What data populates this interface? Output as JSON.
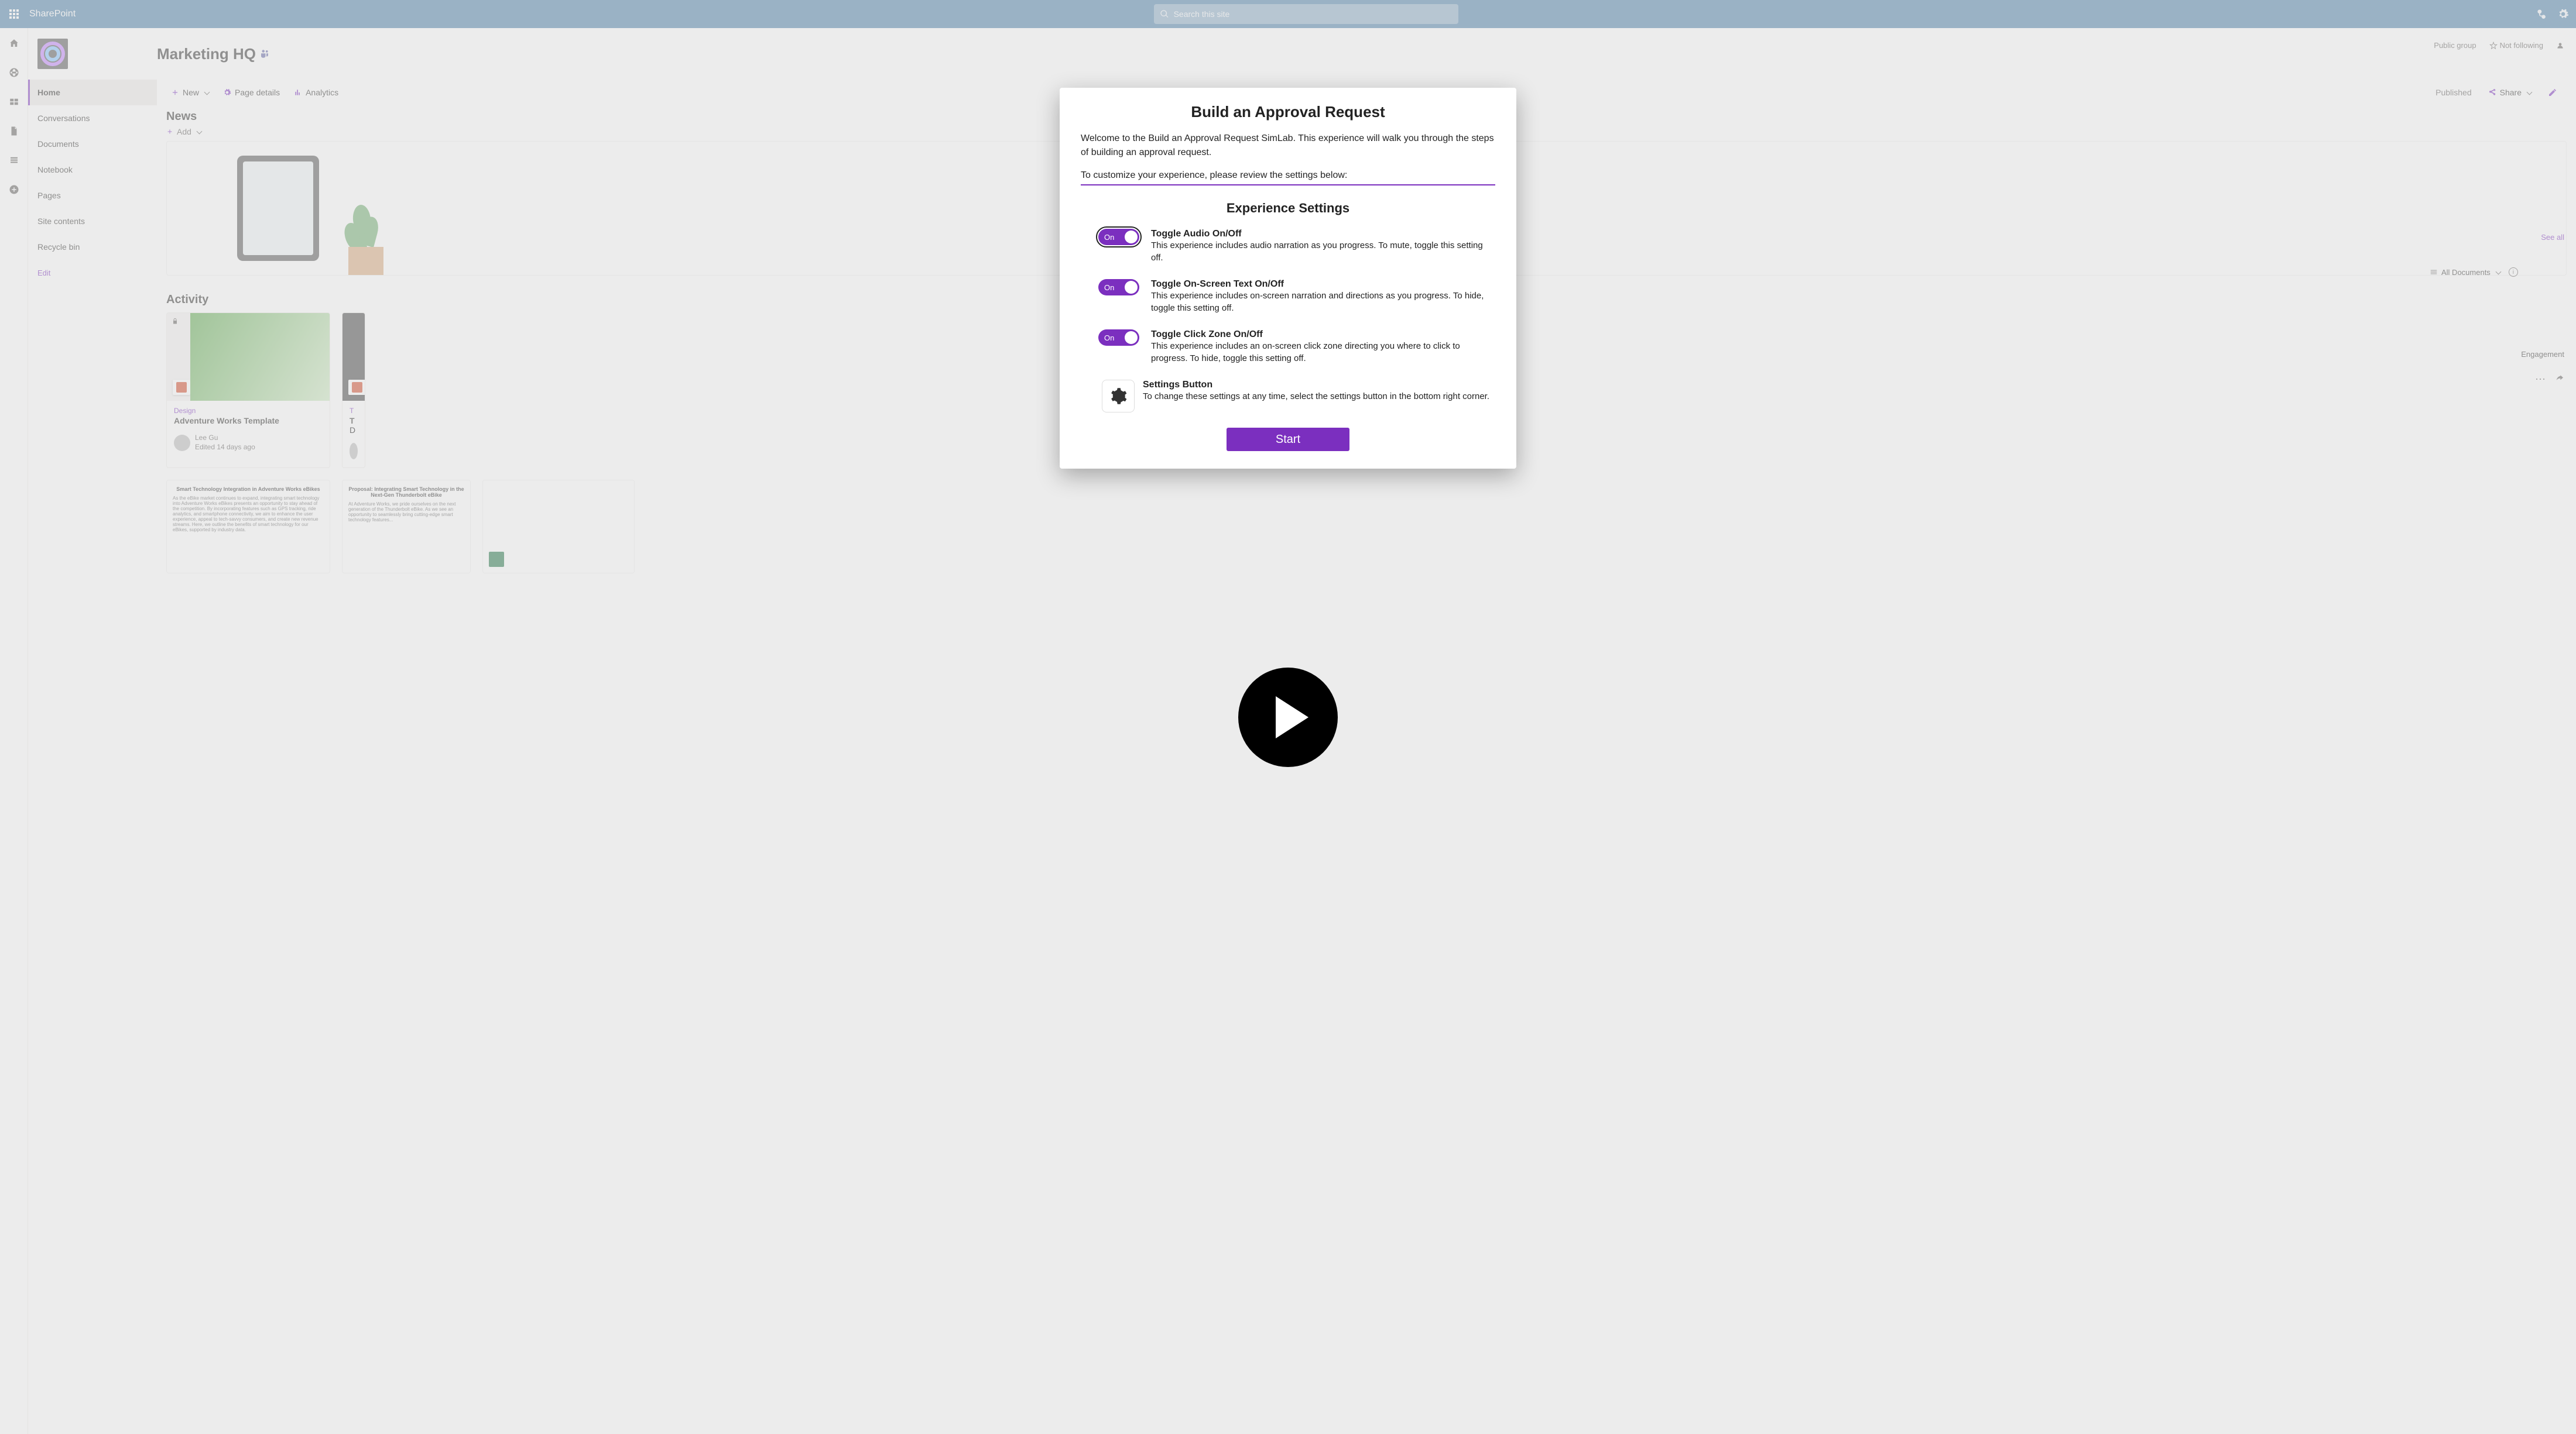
{
  "suite": {
    "product": "SharePoint",
    "search_placeholder": "Search this site"
  },
  "site": {
    "title": "Marketing HQ",
    "visibility": "Public group",
    "follow_label": "Not following"
  },
  "nav": {
    "items": [
      {
        "label": "Home",
        "active": true
      },
      {
        "label": "Conversations"
      },
      {
        "label": "Documents"
      },
      {
        "label": "Notebook"
      },
      {
        "label": "Pages"
      },
      {
        "label": "Site contents"
      },
      {
        "label": "Recycle bin"
      }
    ],
    "edit_label": "Edit"
  },
  "cmdbar": {
    "new": "New",
    "page_details": "Page details",
    "analytics": "Analytics",
    "published": "Published",
    "share": "Share"
  },
  "news": {
    "heading": "News",
    "add": "Add"
  },
  "activity": {
    "heading": "Activity",
    "card1": {
      "tag": "Design",
      "title": "Adventure Works Template",
      "author": "Lee Gu",
      "edited": "Edited 14 days ago"
    },
    "card2": {
      "tag_initial": "T",
      "title_prefix": "T",
      "line2_prefix": "D"
    },
    "doc1": {
      "title": "Smart Technology Integration in Adventure Works eBikes"
    },
    "doc2": {
      "title": "Proposal: Integrating Smart Technology in the Next-Gen Thunderbolt eBike"
    }
  },
  "docs_panel": {
    "see_all": "See all",
    "all_documents": "All Documents",
    "row_label": "Engagement"
  },
  "modal": {
    "title": "Build an Approval Request",
    "intro": "Welcome to the Build an Approval Request SimLab. This experience will walk you through the steps of building an approval request.",
    "customize": "To customize your experience, please review the settings below:",
    "exp_heading": "Experience Settings",
    "toggle_on": "On",
    "audio": {
      "title": "Toggle Audio On/Off",
      "desc": "This experience includes audio narration as you progress. To mute, toggle this setting off."
    },
    "onscreen": {
      "title": "Toggle On-Screen Text On/Off",
      "desc": "This experience includes on-screen narration and directions as you progress. To hide, toggle this setting off."
    },
    "clickzone": {
      "title": "Toggle Click Zone On/Off",
      "desc": "This experience includes an on-screen click zone directing you where to click to progress. To hide, toggle this setting off."
    },
    "settingsbtn": {
      "title": "Settings Button",
      "desc": "To change these settings at any time, select the settings button in the bottom right corner."
    },
    "start": "Start"
  }
}
